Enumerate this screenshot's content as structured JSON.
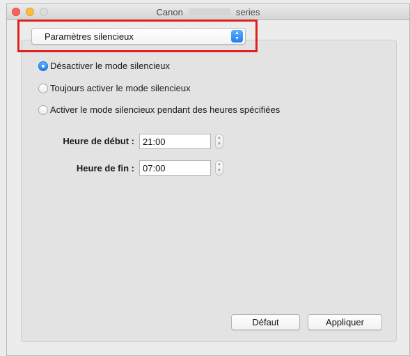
{
  "window": {
    "title_prefix": "Canon",
    "title_suffix": "series"
  },
  "dropdown": {
    "selected": "Paramètres silencieux",
    "arrow_up": "▲",
    "arrow_down": "▼"
  },
  "radios": [
    {
      "label": "Désactiver le mode silencieux",
      "checked": true
    },
    {
      "label": "Toujours activer le mode silencieux",
      "checked": false
    },
    {
      "label": "Activer le mode silencieux pendant des heures spécifiées",
      "checked": false
    }
  ],
  "start_time": {
    "label": "Heure de début :",
    "value": "21:00"
  },
  "end_time": {
    "label": "Heure de fin :",
    "value": "07:00"
  },
  "stepper": {
    "up": "▲",
    "down": "▼"
  },
  "buttons": {
    "default": "Défaut",
    "apply": "Appliquer"
  },
  "colors": {
    "highlight_border": "#e02020",
    "accent_blue": "#1e7ef0"
  }
}
